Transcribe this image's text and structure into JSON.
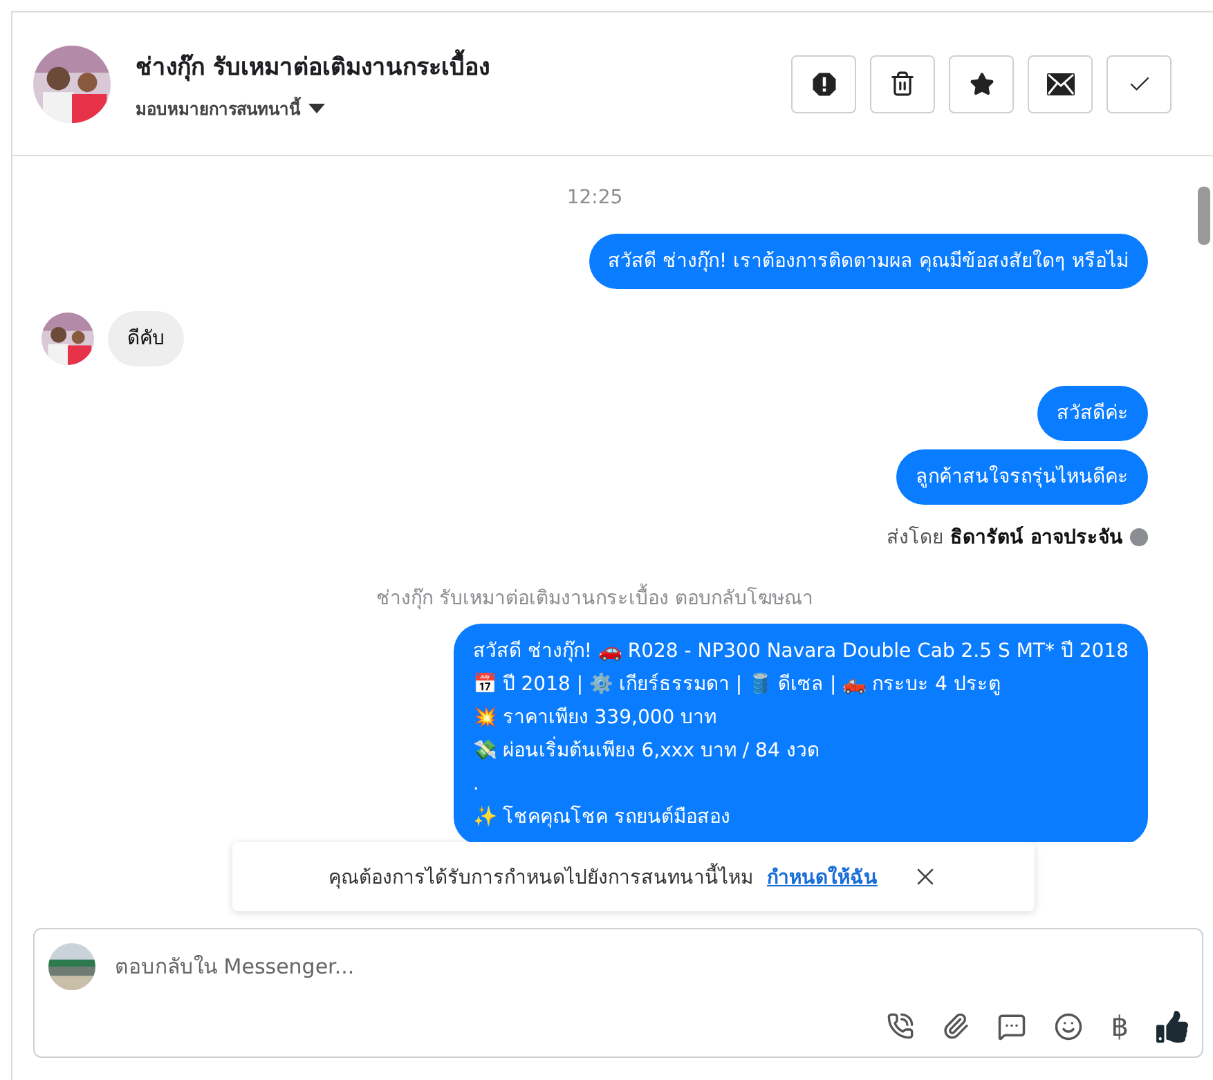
{
  "header": {
    "title": "ช่างกุ๊ก รับเหมาต่อเติมงานกระเบื้อง",
    "assign_label": "มอบหมายการสนทนานี้"
  },
  "actions": [
    {
      "kind": "alert"
    },
    {
      "kind": "trash"
    },
    {
      "kind": "star"
    },
    {
      "kind": "mail"
    },
    {
      "kind": "check"
    }
  ],
  "messages": [
    {
      "kind": "time",
      "text": "12:25"
    },
    {
      "kind": "outgoing",
      "lines": [
        "สวัสดี ช่างกุ๊ก! เราต้องการติดตามผล คุณมีข้อสงสัยใดๆ หรือไม่"
      ]
    },
    {
      "kind": "incoming",
      "lines": [
        "ดีคับ"
      ]
    },
    {
      "kind": "outgoing",
      "lines": [
        "สวัสดีค่ะ"
      ]
    },
    {
      "kind": "outgoing",
      "lines": [
        "ลูกค้าสนใจรถรุ่นไหนดีคะ"
      ]
    },
    {
      "kind": "sender_note",
      "prefix": "ส่งโดย",
      "name": "ธิดารัตน์ อาจประจัน"
    },
    {
      "kind": "ad_note",
      "text": "ช่างกุ๊ก รับเหมาต่อเติมงานกระเบื้อง ตอบกลับโฆษณา"
    },
    {
      "kind": "outgoing",
      "lines": [
        "สวัสดี ช่างกุ๊ก! 🚗 R028 - NP300 Navara Double Cab 2.5 S MT* ปี 2018",
        "📅 ปี 2018 | ⚙️ เกียร์ธรรมดา | 🛢️ ดีเซล | 🛻 กระบะ 4 ประตู",
        "💥 ราคาเพียง 339,000 บาท",
        "💸 ผ่อนเริ่มต้นเพียง 6,xxx บาท / 84 งวด",
        ".",
        "✨ โชคคุณโชค รถยนต์มือสอง"
      ]
    }
  ],
  "banner": {
    "text": "คุณต้องการได้รับการกำหนดไปยังการสนทนานี้ไหม",
    "link": "กำหนดให้ฉัน"
  },
  "composer": {
    "placeholder": "ตอบกลับใน Messenger..."
  },
  "tools": [
    {
      "kind": "call"
    },
    {
      "kind": "attach"
    },
    {
      "kind": "chat"
    },
    {
      "kind": "emoji"
    },
    {
      "kind": "currency",
      "symbol": "฿"
    },
    {
      "kind": "like"
    }
  ]
}
